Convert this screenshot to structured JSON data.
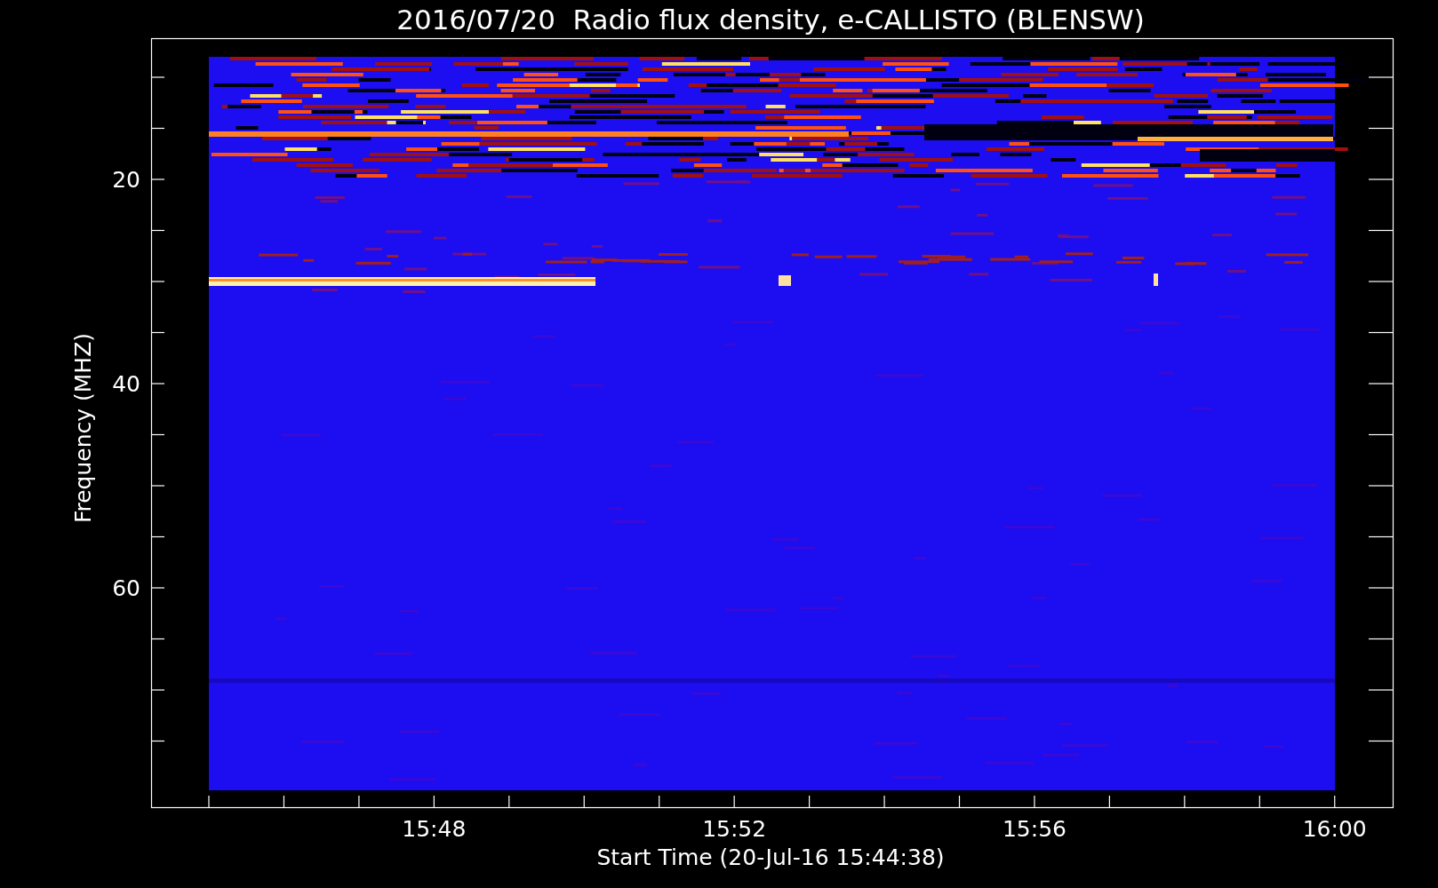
{
  "chart": {
    "title": "2016/07/20  Radio flux density, e-CALLISTO (BLENSW)",
    "ylabel": "Frequency (MHZ)",
    "xlabel": "Start Time (20-Jul-16 15:44:38)",
    "y_tick_labels": [
      "20",
      "40",
      "60"
    ],
    "x_tick_labels": [
      "15:48",
      "15:52",
      "15:56",
      "16:00"
    ]
  }
}
